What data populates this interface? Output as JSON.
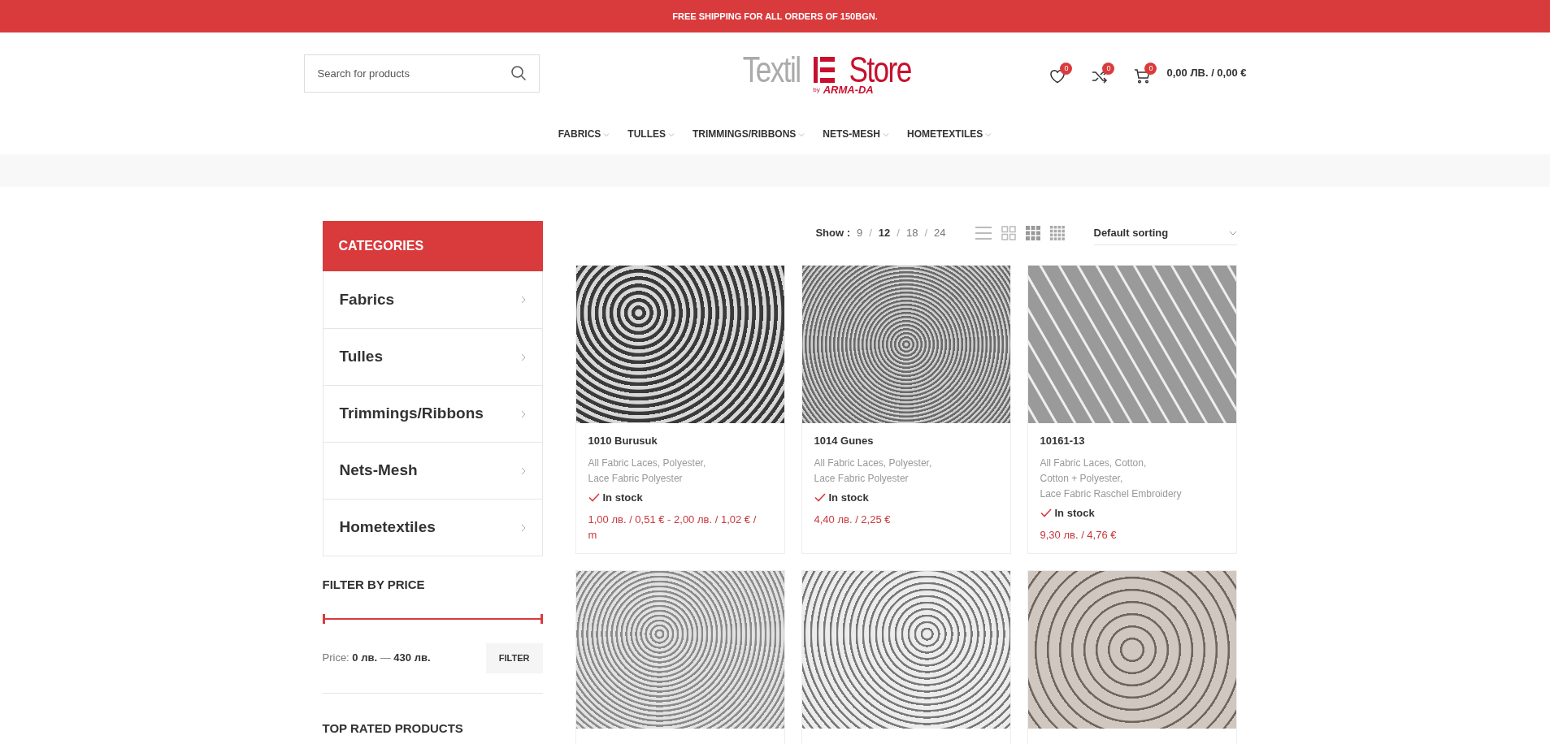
{
  "promo_bar": {
    "text": "FREE SHIPPING FOR ALL ORDERS OF 150BGN."
  },
  "header": {
    "search": {
      "placeholder": "Search for products"
    },
    "logo": {
      "word_left": "Textil",
      "word_right": "Store",
      "by": "by",
      "brand": "ARMA-DA"
    },
    "wishlist_count": "0",
    "compare_count": "0",
    "cart_count": "0",
    "cart_total": "0,00 ЛВ. / 0,00 €"
  },
  "nav": [
    {
      "label": "FABRICS"
    },
    {
      "label": "TULLES"
    },
    {
      "label": "TRIMMINGS/RIBBONS"
    },
    {
      "label": "NETS-MESH"
    },
    {
      "label": "HOMETEXTILES"
    }
  ],
  "sidebar": {
    "categories_title": "CATEGORIES",
    "categories": [
      {
        "label": "Fabrics"
      },
      {
        "label": "Tulles"
      },
      {
        "label": "Trimmings/Ribbons"
      },
      {
        "label": "Nets-Mesh"
      },
      {
        "label": "Hometextiles"
      }
    ],
    "filter_title": "FILTER BY PRICE",
    "price_slider": {
      "level": 1
    },
    "price_label": "Price:",
    "price_min": "0 лв.",
    "price_sep": "—",
    "price_max": "430 лв.",
    "filter_button": "FILTER",
    "top_rated_title": "TOP RATED PRODUCTS"
  },
  "toolbar": {
    "show_label": "Show :",
    "per_page": [
      {
        "label": "9",
        "selected": false
      },
      {
        "label": "12",
        "selected": true
      },
      {
        "label": "18",
        "selected": false
      },
      {
        "label": "24",
        "selected": false
      }
    ],
    "separator": "/",
    "sorting": "Default sorting"
  },
  "products": [
    {
      "kind": "full",
      "title": "1010 Burusuk",
      "categories": [
        "All Fabric Laces, Polyester,",
        "Lace Fabric Polyester"
      ],
      "stock": "In stock",
      "price": "1,00 лв. / 0,51 € - 2,00 лв. / 1,02 € / m"
    },
    {
      "kind": "full",
      "title": "1014 Gunes",
      "categories": [
        "All Fabric Laces, Polyester,",
        "Lace Fabric Polyester"
      ],
      "stock": "In stock",
      "price": "4,40 лв. / 2,25 €"
    },
    {
      "kind": "full",
      "title": "10161-13",
      "categories": [
        "All Fabric Laces, Cotton,",
        "Cotton + Polyester,",
        "Lace Fabric Raschel Embroidery"
      ],
      "stock": "In stock",
      "price": "9,30 лв. / 4,76 €"
    },
    {
      "kind": "photo_only"
    },
    {
      "kind": "photo_only"
    },
    {
      "kind": "photo_only"
    }
  ]
}
